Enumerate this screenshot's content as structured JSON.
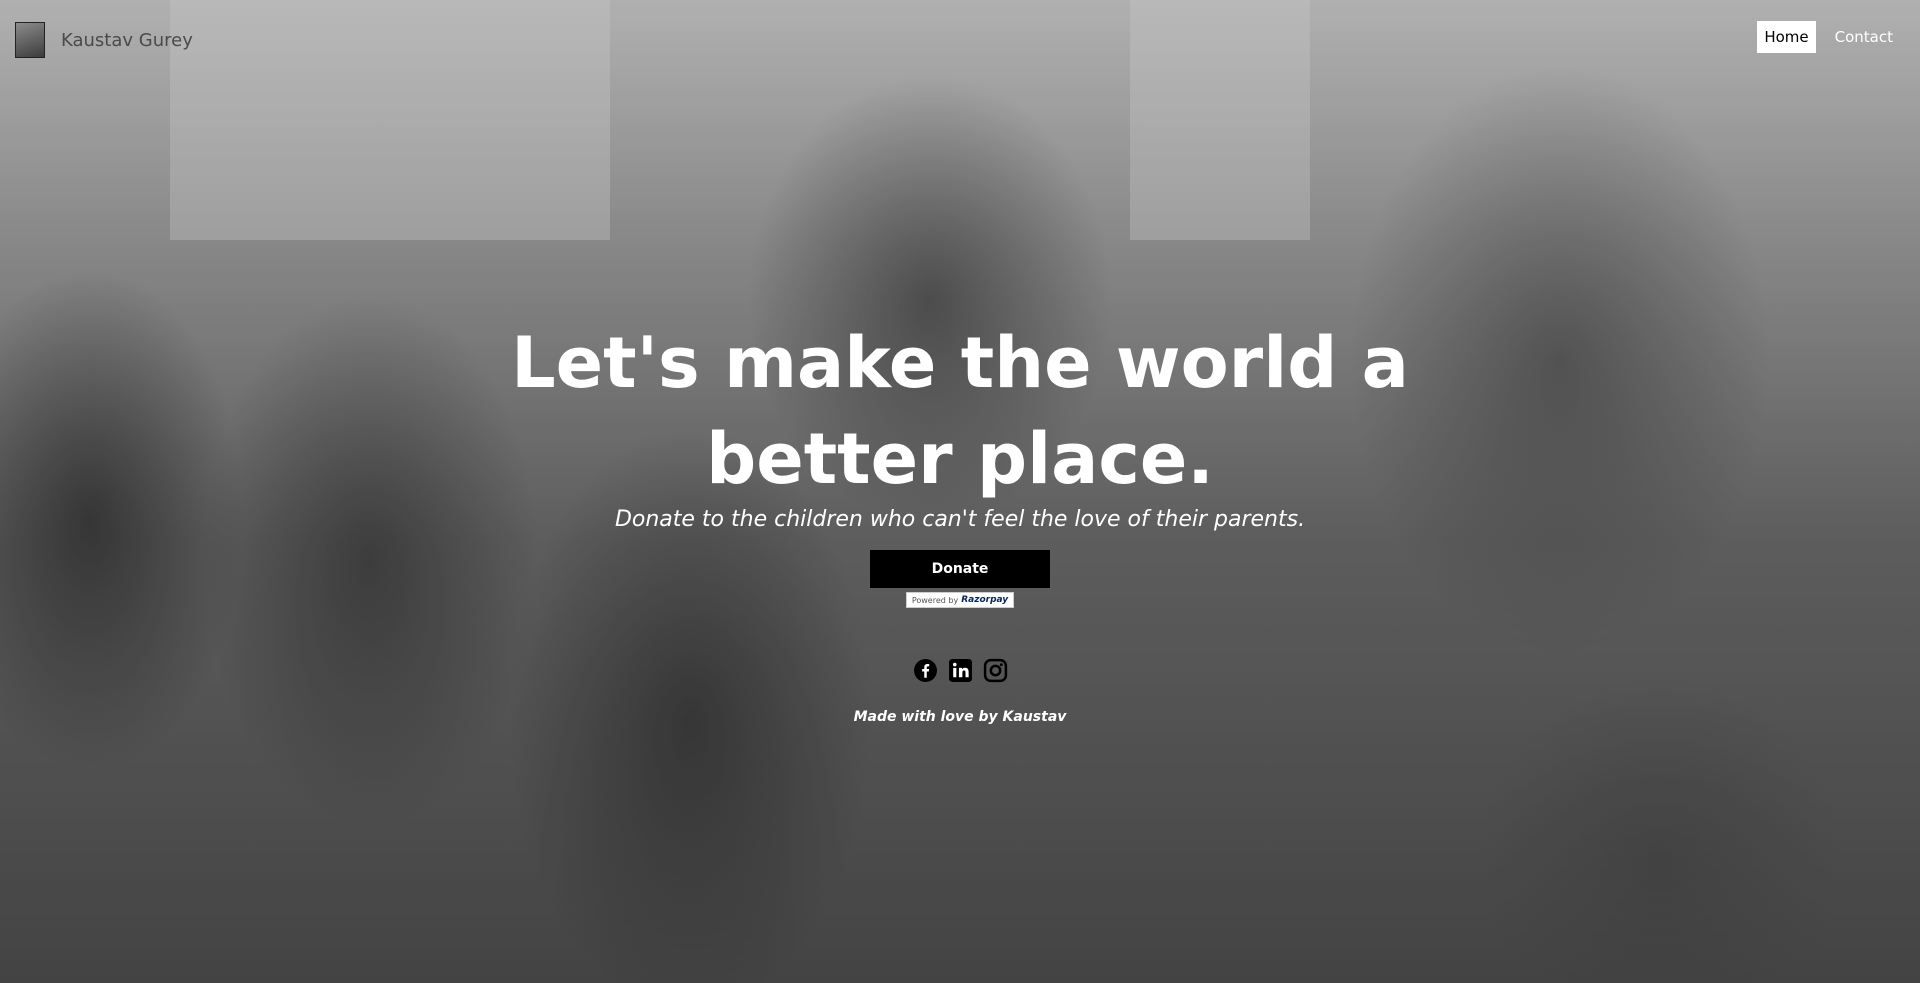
{
  "nav": {
    "brand_name": "Kaustav Gurey",
    "links": [
      {
        "label": "Home",
        "active": true
      },
      {
        "label": "Contact",
        "active": false
      }
    ]
  },
  "hero": {
    "title": "Let's make the world a better place.",
    "subtitle": "Donate to the children who can't feel the love of their parents.",
    "donate_label": "Donate",
    "powered_by": "Powered by",
    "payment_brand": "Razorpay"
  },
  "socials": [
    {
      "icon": "facebook-icon"
    },
    {
      "icon": "linkedin-icon"
    },
    {
      "icon": "instagram-icon"
    }
  ],
  "footer": {
    "note": "Made with love by Kaustav"
  }
}
